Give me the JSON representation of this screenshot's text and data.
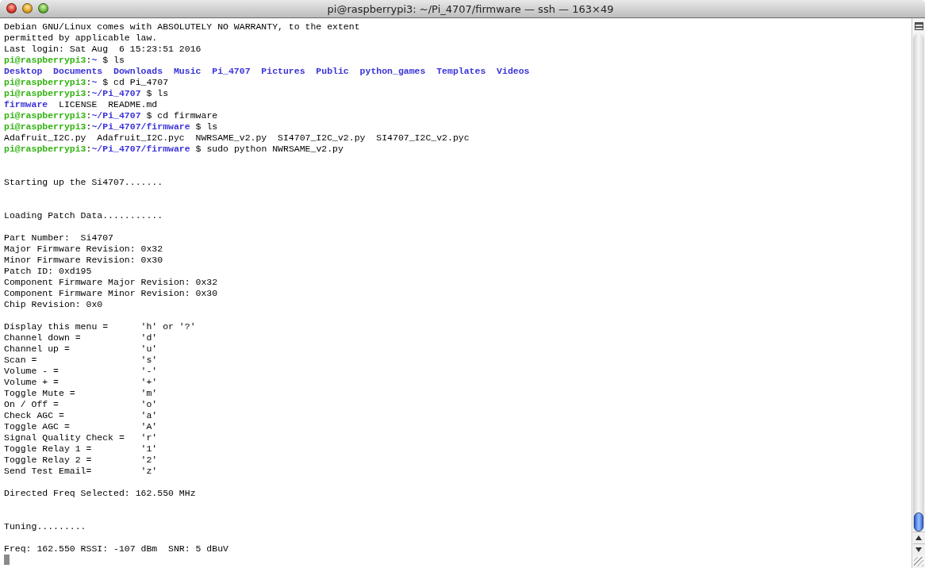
{
  "window": {
    "title": "pi@raspberrypi3: ~/Pi_4707/firmware — ssh — 163×49"
  },
  "terminal": {
    "cursor": true,
    "lines": [
      {
        "kind": "text",
        "segments": [
          {
            "kind": "plain",
            "text": "Debian GNU/Linux comes with ABSOLUTELY NO WARRANTY, to the extent"
          }
        ]
      },
      {
        "kind": "text",
        "segments": [
          {
            "kind": "plain",
            "text": "permitted by applicable law."
          }
        ]
      },
      {
        "kind": "text",
        "segments": [
          {
            "kind": "plain",
            "text": "Last login: Sat Aug  6 15:23:51 2016"
          }
        ]
      },
      {
        "kind": "text",
        "segments": [
          {
            "kind": "user",
            "text": "pi@raspberrypi3"
          },
          {
            "kind": "plain",
            "text": ":"
          },
          {
            "kind": "path",
            "text": "~"
          },
          {
            "kind": "plain",
            "text": " $ ls"
          }
        ]
      },
      {
        "kind": "text",
        "segments": [
          {
            "kind": "dir",
            "text": "Desktop  Documents  Downloads  Music  Pi_4707  Pictures  Public  python_games  Templates  Videos"
          }
        ]
      },
      {
        "kind": "text",
        "segments": [
          {
            "kind": "user",
            "text": "pi@raspberrypi3"
          },
          {
            "kind": "plain",
            "text": ":"
          },
          {
            "kind": "path",
            "text": "~"
          },
          {
            "kind": "plain",
            "text": " $ cd Pi_4707"
          }
        ]
      },
      {
        "kind": "text",
        "segments": [
          {
            "kind": "user",
            "text": "pi@raspberrypi3"
          },
          {
            "kind": "plain",
            "text": ":"
          },
          {
            "kind": "path",
            "text": "~/Pi_4707"
          },
          {
            "kind": "plain",
            "text": " $ ls"
          }
        ]
      },
      {
        "kind": "text",
        "segments": [
          {
            "kind": "dir",
            "text": "firmware"
          },
          {
            "kind": "plain",
            "text": "  LICENSE  README.md"
          }
        ]
      },
      {
        "kind": "text",
        "segments": [
          {
            "kind": "user",
            "text": "pi@raspberrypi3"
          },
          {
            "kind": "plain",
            "text": ":"
          },
          {
            "kind": "path",
            "text": "~/Pi_4707"
          },
          {
            "kind": "plain",
            "text": " $ cd firmware"
          }
        ]
      },
      {
        "kind": "text",
        "segments": [
          {
            "kind": "user",
            "text": "pi@raspberrypi3"
          },
          {
            "kind": "plain",
            "text": ":"
          },
          {
            "kind": "path",
            "text": "~/Pi_4707/firmware"
          },
          {
            "kind": "plain",
            "text": " $ ls"
          }
        ]
      },
      {
        "kind": "text",
        "segments": [
          {
            "kind": "plain",
            "text": "Adafruit_I2C.py  Adafruit_I2C.pyc  NWRSAME_v2.py  SI4707_I2C_v2.py  SI4707_I2C_v2.pyc"
          }
        ]
      },
      {
        "kind": "text",
        "segments": [
          {
            "kind": "user",
            "text": "pi@raspberrypi3"
          },
          {
            "kind": "plain",
            "text": ":"
          },
          {
            "kind": "path",
            "text": "~/Pi_4707/firmware"
          },
          {
            "kind": "plain",
            "text": " $ sudo python NWRSAME_v2.py"
          }
        ]
      },
      {
        "kind": "blank"
      },
      {
        "kind": "blank"
      },
      {
        "kind": "text",
        "segments": [
          {
            "kind": "plain",
            "text": "Starting up the Si4707......."
          }
        ]
      },
      {
        "kind": "blank"
      },
      {
        "kind": "blank"
      },
      {
        "kind": "text",
        "segments": [
          {
            "kind": "plain",
            "text": "Loading Patch Data..........."
          }
        ]
      },
      {
        "kind": "blank"
      },
      {
        "kind": "text",
        "segments": [
          {
            "kind": "plain",
            "text": "Part Number:  Si4707"
          }
        ]
      },
      {
        "kind": "text",
        "segments": [
          {
            "kind": "plain",
            "text": "Major Firmware Revision: 0x32"
          }
        ]
      },
      {
        "kind": "text",
        "segments": [
          {
            "kind": "plain",
            "text": "Minor Firmware Revision: 0x30"
          }
        ]
      },
      {
        "kind": "text",
        "segments": [
          {
            "kind": "plain",
            "text": "Patch ID: 0xd195"
          }
        ]
      },
      {
        "kind": "text",
        "segments": [
          {
            "kind": "plain",
            "text": "Component Firmware Major Revision: 0x32"
          }
        ]
      },
      {
        "kind": "text",
        "segments": [
          {
            "kind": "plain",
            "text": "Component Firmware Minor Revision: 0x30"
          }
        ]
      },
      {
        "kind": "text",
        "segments": [
          {
            "kind": "plain",
            "text": "Chip Revision: 0x0"
          }
        ]
      },
      {
        "kind": "blank"
      },
      {
        "kind": "text",
        "segments": [
          {
            "kind": "plain",
            "text": "Display this menu =      'h' or '?'"
          }
        ]
      },
      {
        "kind": "text",
        "segments": [
          {
            "kind": "plain",
            "text": "Channel down =           'd'"
          }
        ]
      },
      {
        "kind": "text",
        "segments": [
          {
            "kind": "plain",
            "text": "Channel up =             'u'"
          }
        ]
      },
      {
        "kind": "text",
        "segments": [
          {
            "kind": "plain",
            "text": "Scan =                   's'"
          }
        ]
      },
      {
        "kind": "text",
        "segments": [
          {
            "kind": "plain",
            "text": "Volume - =               '-'"
          }
        ]
      },
      {
        "kind": "text",
        "segments": [
          {
            "kind": "plain",
            "text": "Volume + =               '+'"
          }
        ]
      },
      {
        "kind": "text",
        "segments": [
          {
            "kind": "plain",
            "text": "Toggle Mute =            'm'"
          }
        ]
      },
      {
        "kind": "text",
        "segments": [
          {
            "kind": "plain",
            "text": "On / Off =               'o'"
          }
        ]
      },
      {
        "kind": "text",
        "segments": [
          {
            "kind": "plain",
            "text": "Check AGC =              'a'"
          }
        ]
      },
      {
        "kind": "text",
        "segments": [
          {
            "kind": "plain",
            "text": "Toggle AGC =             'A'"
          }
        ]
      },
      {
        "kind": "text",
        "segments": [
          {
            "kind": "plain",
            "text": "Signal Quality Check =   'r'"
          }
        ]
      },
      {
        "kind": "text",
        "segments": [
          {
            "kind": "plain",
            "text": "Toggle Relay 1 =         '1'"
          }
        ]
      },
      {
        "kind": "text",
        "segments": [
          {
            "kind": "plain",
            "text": "Toggle Relay 2 =         '2'"
          }
        ]
      },
      {
        "kind": "text",
        "segments": [
          {
            "kind": "plain",
            "text": "Send Test Email=         'z'"
          }
        ]
      },
      {
        "kind": "blank"
      },
      {
        "kind": "text",
        "segments": [
          {
            "kind": "plain",
            "text": "Directed Freq Selected: 162.550 MHz"
          }
        ]
      },
      {
        "kind": "blank"
      },
      {
        "kind": "blank"
      },
      {
        "kind": "text",
        "segments": [
          {
            "kind": "plain",
            "text": "Tuning........."
          }
        ]
      },
      {
        "kind": "blank"
      },
      {
        "kind": "text",
        "segments": [
          {
            "kind": "plain",
            "text": "Freq: 162.550 RSSI: -107 dBm  SNR: 5 dBuV"
          }
        ]
      }
    ]
  }
}
